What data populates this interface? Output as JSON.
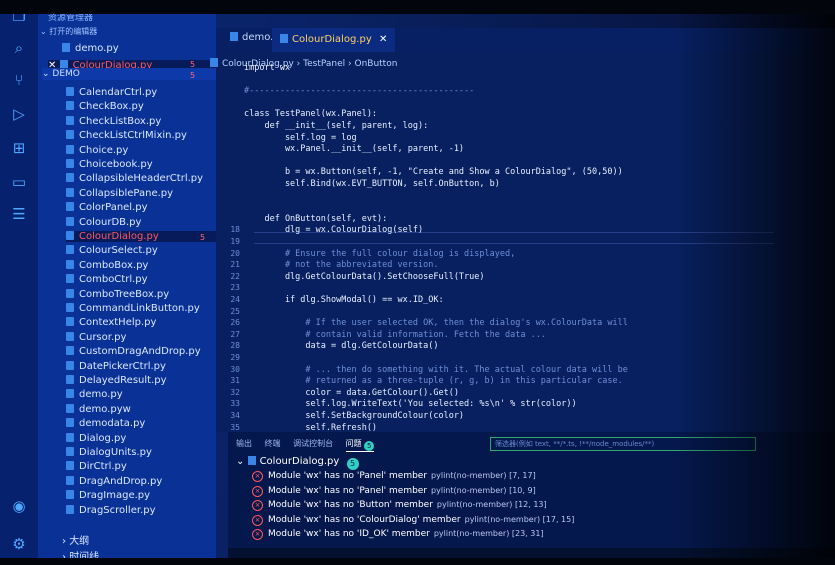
{
  "sidebar": {
    "title": "资源管理器",
    "open_editors_header": "打开的编辑器",
    "open_editors": [
      {
        "name": "demo.py",
        "state": "normal"
      },
      {
        "name": "ColourDialog.py",
        "state": "error",
        "count": "5"
      }
    ],
    "folder": "DEMO",
    "folder_badge": "5",
    "files": [
      "CalendarCtrl.py",
      "CheckBox.py",
      "CheckListBox.py",
      "CheckListCtrlMixin.py",
      "Choice.py",
      "Choicebook.py",
      "CollapsibleHeaderCtrl.py",
      "CollapsiblePane.py",
      "ColorPanel.py",
      "ColourDB.py",
      "ColourDialog.py",
      "ColourSelect.py",
      "ComboBox.py",
      "ComboCtrl.py",
      "ComboTreeBox.py",
      "CommandLinkButton.py",
      "ContextHelp.py",
      "Cursor.py",
      "CustomDragAndDrop.py",
      "DatePickerCtrl.py",
      "DelayedResult.py",
      "demo.py",
      "demo.pyw",
      "demodata.py",
      "Dialog.py",
      "DialogUnits.py",
      "DirCtrl.py",
      "DragAndDrop.py",
      "DragImage.py",
      "DragScroller.py"
    ],
    "active_file": "ColourDialog.py",
    "active_badge": "5",
    "footer_items": [
      "大纲",
      "时间线"
    ]
  },
  "editor": {
    "tabs": [
      {
        "label": "demo.py",
        "active": false
      },
      {
        "label": "ColourDialog.py",
        "active": true
      }
    ],
    "breadcrumb": [
      "ColourDialog.py",
      "TestPanel",
      "OnButton"
    ],
    "lines": [
      {
        "n": "",
        "t": "import wx"
      },
      {
        "n": "",
        "t": ""
      },
      {
        "n": "",
        "t": "#--------------------------------------------"
      },
      {
        "n": "",
        "t": ""
      },
      {
        "n": "",
        "t": "class TestPanel(wx.Panel):"
      },
      {
        "n": "",
        "t": "    def __init__(self, parent, log):"
      },
      {
        "n": "",
        "t": "        self.log = log"
      },
      {
        "n": "",
        "t": "        wx.Panel.__init__(self, parent, -1)"
      },
      {
        "n": "",
        "t": ""
      },
      {
        "n": "",
        "t": "        b = wx.Button(self, -1, \"Create and Show a ColourDialog\", (50,50))"
      },
      {
        "n": "",
        "t": "        self.Bind(wx.EVT_BUTTON, self.OnButton, b)"
      },
      {
        "n": "",
        "t": ""
      },
      {
        "n": "",
        "t": ""
      },
      {
        "n": "",
        "t": "    def OnButton(self, evt):"
      },
      {
        "n": "18",
        "t": "        dlg = wx.ColourDialog(self)"
      },
      {
        "n": "19",
        "t": ""
      },
      {
        "n": "20",
        "t": "        # Ensure the full colour dialog is displayed,"
      },
      {
        "n": "21",
        "t": "        # not the abbreviated version."
      },
      {
        "n": "22",
        "t": "        dlg.GetColourData().SetChooseFull(True)"
      },
      {
        "n": "23",
        "t": ""
      },
      {
        "n": "24",
        "t": "        if dlg.ShowModal() == wx.ID_OK:"
      },
      {
        "n": "25",
        "t": ""
      },
      {
        "n": "26",
        "t": "            # If the user selected OK, then the dialog's wx.ColourData will"
      },
      {
        "n": "27",
        "t": "            # contain valid information. Fetch the data ..."
      },
      {
        "n": "28",
        "t": "            data = dlg.GetColourData()"
      },
      {
        "n": "29",
        "t": ""
      },
      {
        "n": "30",
        "t": "            # ... then do something with it. The actual colour data will be"
      },
      {
        "n": "31",
        "t": "            # returned as a three-tuple (r, g, b) in this particular case."
      },
      {
        "n": "32",
        "t": "            color = data.GetColour().Get()"
      },
      {
        "n": "33",
        "t": "            self.log.WriteText('You selected: %s\\n' % str(color))"
      },
      {
        "n": "34",
        "t": "            self.SetBackgroundColour(color)"
      },
      {
        "n": "35",
        "t": "            self.Refresh()"
      }
    ]
  },
  "panel": {
    "tabs": [
      "输出",
      "终端",
      "调试控制台",
      "问题"
    ],
    "problem_count": "5",
    "filter_placeholder": "筛选器(例如 text, **/*.ts, !**/node_modules/**)",
    "file": "ColourDialog.py",
    "file_count": "5",
    "problems": [
      {
        "msg": "Module 'wx' has no 'Panel' member",
        "src": "pylint(no-member) [7, 17]"
      },
      {
        "msg": "Module 'wx' has no 'Panel' member",
        "src": "pylint(no-member) [10, 9]"
      },
      {
        "msg": "Module 'wx' has no 'Button' member",
        "src": "pylint(no-member) [12, 13]"
      },
      {
        "msg": "Module 'wx' has no 'ColourDialog' member",
        "src": "pylint(no-member) [17, 15]"
      },
      {
        "msg": "Module 'wx' has no 'ID_OK' member",
        "src": "pylint(no-member) [23, 31]"
      }
    ]
  }
}
